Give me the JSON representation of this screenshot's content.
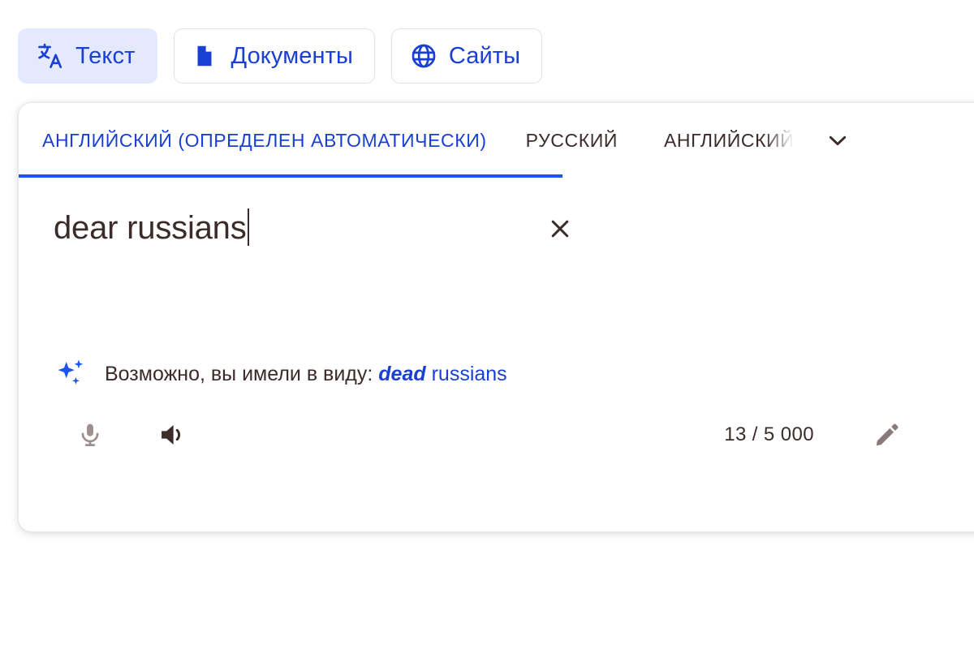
{
  "mode_tabs": [
    {
      "id": "text",
      "label": "Текст",
      "icon": "translate-icon",
      "active": true
    },
    {
      "id": "documents",
      "label": "Документы",
      "icon": "document-icon",
      "active": false
    },
    {
      "id": "websites",
      "label": "Сайты",
      "icon": "globe-icon",
      "active": false
    }
  ],
  "language_tabs": {
    "source_active": "АНГЛИЙСКИЙ (ОПРЕДЕЛЕН АВТОМАТИЧЕСКИ)",
    "option_russian": "РУССКИЙ",
    "option_english": "АНГЛИЙСКИЙ",
    "expand_icon": "chevron-down-icon"
  },
  "source": {
    "text": "dear russians",
    "clear_icon": "close-icon"
  },
  "suggestion": {
    "icon": "sparkle-icon",
    "prefix": "Возможно, вы имели в виду: ",
    "correction": "dead",
    "rest": " russians"
  },
  "toolbar": {
    "mic_icon": "microphone-icon",
    "listen_icon": "speaker-icon",
    "char_count": "13 / 5 000",
    "edit_icon": "pencil-icon"
  },
  "colors": {
    "accent_blue": "#1a3fd4",
    "underline_blue": "#1a56ec",
    "active_tab_bg": "#e4e9fd",
    "text_dark": "#3c2b2b",
    "mic_gray": "#9e9090"
  }
}
